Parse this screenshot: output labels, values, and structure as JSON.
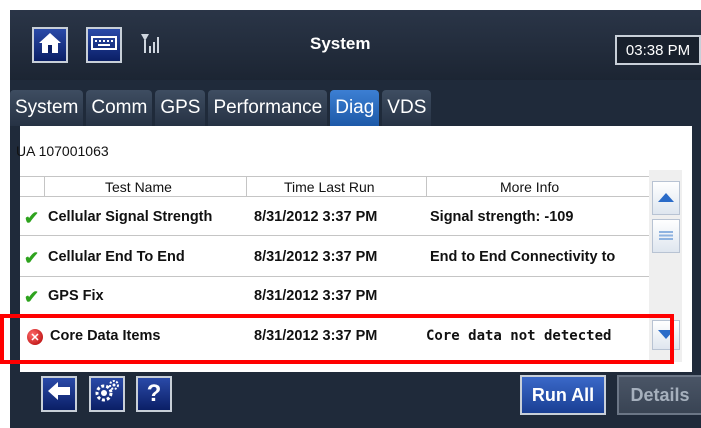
{
  "header": {
    "title": "System",
    "time": "03:38 PM"
  },
  "tabs": [
    "System",
    "Comm",
    "GPS",
    "Performance",
    "Diag",
    "VDS"
  ],
  "active_tab": "Diag",
  "unit": "UA 107001063",
  "columns": [
    "Test Name",
    "Time Last Run",
    "More Info"
  ],
  "rows": [
    {
      "status": "pass",
      "name": "Cellular Signal Strength",
      "time": "8/31/2012 3:37 PM",
      "info": "Signal strength: -109"
    },
    {
      "status": "pass",
      "name": "Cellular End To End",
      "time": "8/31/2012 3:37 PM",
      "info": "End to End Connectivity to"
    },
    {
      "status": "pass",
      "name": "GPS Fix",
      "time": "8/31/2012 3:37 PM",
      "info": ""
    },
    {
      "status": "fail",
      "name": "Core Data Items",
      "time": "8/31/2012 3:37 PM",
      "info": "Core data not detected"
    }
  ],
  "buttons": {
    "run_all": "Run All",
    "details": "Details",
    "help": "?"
  },
  "icons": [
    "home-icon",
    "keyboard-icon",
    "signal-icon",
    "back-arrow-icon",
    "settings-gears-icon",
    "help-icon",
    "scroll-up-icon",
    "scroll-thumb-icon",
    "scroll-down-icon",
    "check-icon",
    "error-icon"
  ],
  "colors": {
    "accent": "#2a6bc8",
    "pass": "#2ea31e",
    "fail": "#c40000",
    "highlight": "#ff0000"
  }
}
